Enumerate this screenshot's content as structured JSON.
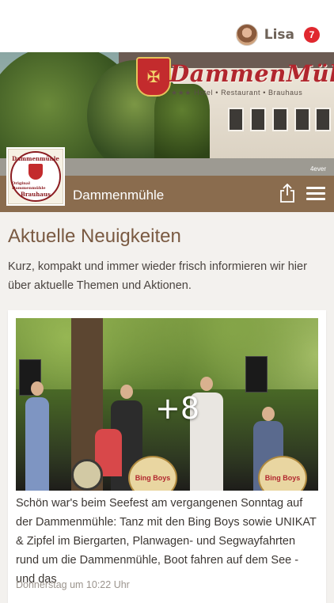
{
  "user": {
    "name": "Lisa",
    "notification_count": "7"
  },
  "hero": {
    "title": "DammenMühle",
    "subtitle": "★★★ Hotel • Restaurant • Brauhaus",
    "photo_credit": "4ever"
  },
  "brand": {
    "name": "Dammenmühle",
    "logo_text_top": "Dammenmühle",
    "logo_text_mid": "Original Dammenmühle",
    "logo_text_bottom": "Brauhaus"
  },
  "news": {
    "heading": "Aktuelle Neuigkeiten",
    "intro": "Kurz, kompakt und immer wieder frisch informieren wir hier über aktuelle Themen und Aktionen.",
    "posts": [
      {
        "extra_images": "+8",
        "drum_label": "Bing Boys",
        "text": "Schön war's beim Seefest am vergangenen Sonntag auf der Dammenmühle: Tanz mit den Bing Boys sowie UNIKAT & Zipfel im Biergarten, Planwagen- und Segwayfahrten rund um die Dammenmühle, Boot fahren auf dem See - und das",
        "date": "Donnerstag um 10:22 Uhr"
      }
    ]
  },
  "colors": {
    "brand_bar": "#8a6c4e",
    "heading": "#7a5a42",
    "badge": "#e0282f",
    "background": "#f3f1ee"
  }
}
